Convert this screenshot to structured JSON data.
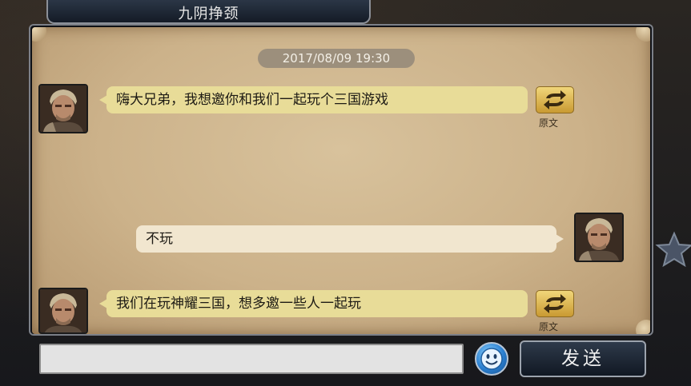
{
  "header": {
    "title": "九阴挣颈"
  },
  "chat": {
    "timestamp": "2017/08/09 19:30",
    "messages": [
      {
        "direction": "incoming",
        "text": "嗨大兄弟，我想邀你和我们一起玩个三国游戏",
        "translate_label": "原文"
      },
      {
        "direction": "outgoing",
        "text": "不玩"
      },
      {
        "direction": "incoming",
        "text": "我们在玩神耀三国，想多邀一些人一起玩",
        "translate_label": "原文"
      }
    ]
  },
  "composer": {
    "input_value": "",
    "input_placeholder": "",
    "send_label": "发送"
  },
  "icons": {
    "translate": "swap-arrows-icon",
    "emoji": "smiley-icon",
    "side": "star-icon"
  },
  "colors": {
    "parchment": "#ccb28a",
    "incoming_bubble": "#e8dc98",
    "outgoing_bubble": "#f1e6cf",
    "translate_button": "#d9ad45",
    "emoji_button": "#2a7fd0"
  }
}
